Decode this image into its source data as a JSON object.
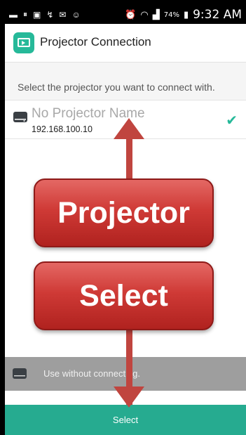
{
  "status_bar": {
    "left_icons": [
      "keyboard-icon",
      "pause-icon",
      "image-icon",
      "missed-call-icon",
      "mail-icon",
      "bug-icon"
    ],
    "right_icons": [
      "alarm-icon",
      "wifi-icon",
      "signal-icon",
      "battery-icon"
    ],
    "battery": "74%",
    "time": "9:32 AM"
  },
  "header": {
    "title": "Projector Connection"
  },
  "instruction": "Select the projector you want to connect with.",
  "projectors": [
    {
      "name": "No Projector Name",
      "ip": "192.168.100.10",
      "selected": true
    }
  ],
  "without_connecting": {
    "label": "Use without connecting."
  },
  "select_button": {
    "label": "Select"
  },
  "annotations": {
    "callout_1": "Projector",
    "callout_2": "Select"
  },
  "colors": {
    "accent": "#26ab90",
    "callout_red": "#cf3a36",
    "disabled_row": "#9e9e9e"
  }
}
